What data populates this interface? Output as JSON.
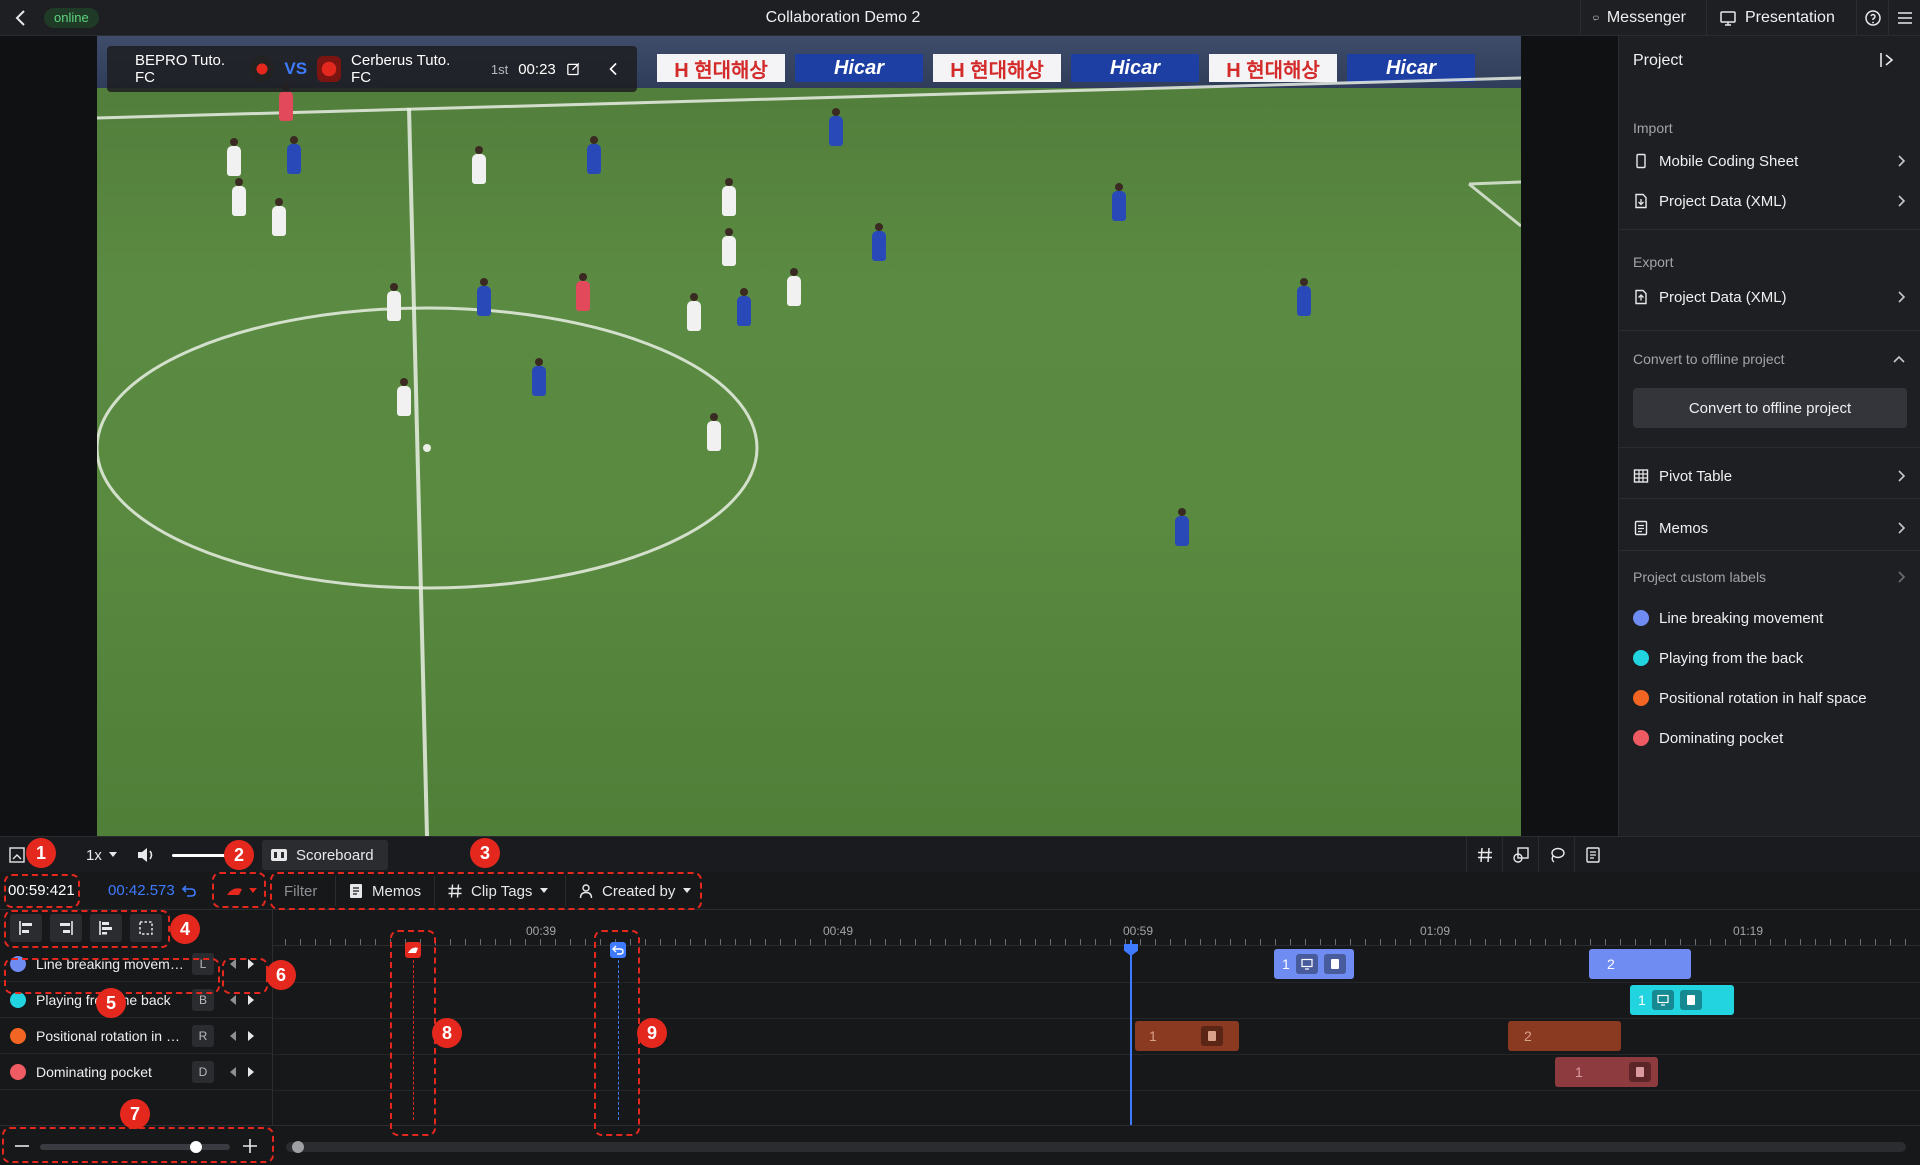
{
  "topbar": {
    "status": "online",
    "title": "Collaboration Demo 2",
    "messenger": "Messenger",
    "presentation": "Presentation"
  },
  "video": {
    "home_team": "BEPRO Tuto. FC",
    "vs": "VS",
    "away_team": "Cerberus Tuto. FC",
    "period": "1st",
    "time": "00:23",
    "ads": [
      "H 현대해상",
      "Hicar",
      "H 현대해상",
      "Hicar",
      "H 현대해상",
      "Hicar"
    ]
  },
  "right_panel": {
    "title": "Project",
    "import_label": "Import",
    "import_items": [
      "Mobile Coding Sheet",
      "Project Data (XML)"
    ],
    "export_label": "Export",
    "export_items": [
      "Project Data (XML)"
    ],
    "convert_label": "Convert to offline project",
    "convert_button": "Convert to offline project",
    "pivot_table": "Pivot Table",
    "memos": "Memos",
    "custom_labels_title": "Project custom labels",
    "custom_labels": [
      {
        "name": "Line breaking movement",
        "color": "#6f8cf2"
      },
      {
        "name": "Playing from the back",
        "color": "#22d3e0"
      },
      {
        "name": "Positional rotation in half space",
        "color": "#f26522"
      },
      {
        "name": "Dominating pocket",
        "color": "#ef5b63"
      }
    ]
  },
  "controls": {
    "speed": "1x",
    "scoreboard": "Scoreboard"
  },
  "filter_row": {
    "current_time": "00:59:421",
    "clip_duration": "00:42.573",
    "filter": "Filter",
    "memos": "Memos",
    "clip_tags": "Clip Tags",
    "created_by": "Created by"
  },
  "timeline": {
    "tick_labels": [
      "00:39",
      "00:49",
      "00:59",
      "01:09",
      "01:19"
    ],
    "labels": [
      {
        "name": "Line breaking movement",
        "hotkey": "L",
        "color": "#6f8cf2"
      },
      {
        "name": "Playing from the back",
        "hotkey": "B",
        "color": "#22d3e0"
      },
      {
        "name": "Positional rotation in half space",
        "hotkey": "R",
        "color": "#f26522"
      },
      {
        "name": "Dominating pocket",
        "hotkey": "D",
        "color": "#ef5b63"
      }
    ],
    "clips": [
      {
        "track": 0,
        "number": "1"
      },
      {
        "track": 0,
        "number": "2"
      },
      {
        "track": 1,
        "number": "1"
      },
      {
        "track": 2,
        "number": "1"
      },
      {
        "track": 2,
        "number": "2"
      },
      {
        "track": 3,
        "number": "1"
      }
    ]
  },
  "annotations": [
    "1",
    "2",
    "3",
    "4",
    "5",
    "6",
    "7",
    "8",
    "9"
  ]
}
